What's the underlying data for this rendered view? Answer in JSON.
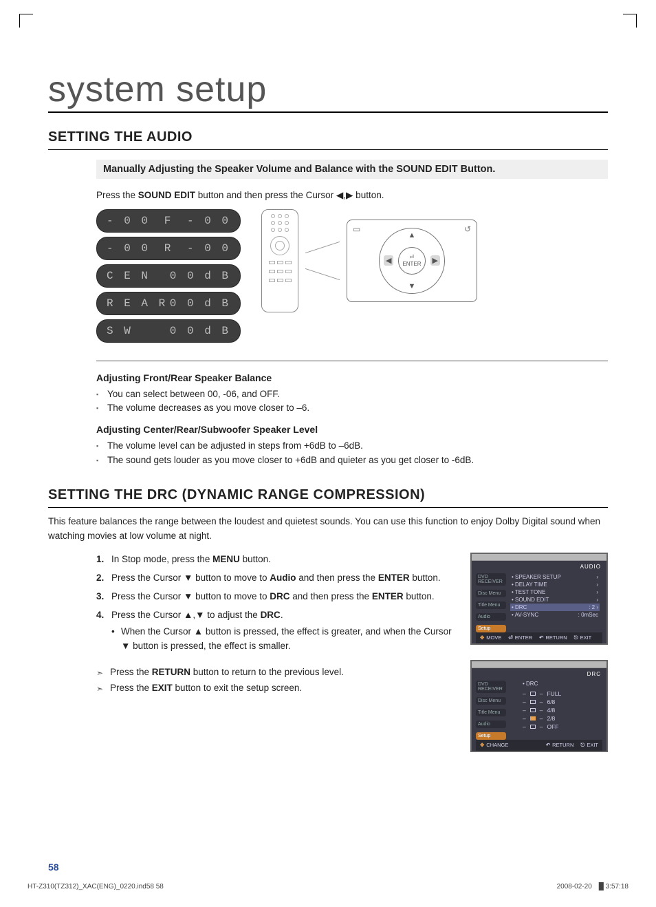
{
  "chapter_title": "system setup",
  "section1": {
    "heading": "SETTING THE AUDIO",
    "sub_band": "Manually Adjusting the Speaker Volume and Balance with the SOUND EDIT Button.",
    "instruction_pre": "Press the ",
    "instruction_bold": "SOUND EDIT",
    "instruction_post": " button and then press the Cursor ◀,▶ button.",
    "lcd": [
      {
        "left": "- 0 0",
        "mid": "F",
        "right": "- 0 0"
      },
      {
        "left": "- 0 0",
        "mid": "R",
        "right": "- 0 0"
      },
      {
        "left": "C E N",
        "mid": "",
        "right": "0 0 d B"
      },
      {
        "left": "R E A R",
        "mid": "",
        "right": "0 0 d B"
      },
      {
        "left": "S W",
        "mid": "",
        "right": "0 0 d B"
      }
    ],
    "dpad": {
      "corner_tl": "▭",
      "corner_tr": "↺",
      "center_icon": "⏎",
      "center_label": "ENTER"
    },
    "adj1_head": "Adjusting Front/Rear Speaker Balance",
    "adj1_b1": "You can select between 00, -06, and OFF.",
    "adj1_b2": "The volume decreases as you move closer to –6.",
    "adj2_head": "Adjusting Center/Rear/Subwoofer Speaker Level",
    "adj2_b1": "The volume level can be adjusted in steps from +6dB to –6dB.",
    "adj2_b2": "The sound gets louder as you move closer to +6dB and quieter as you get closer to -6dB."
  },
  "section2": {
    "heading": "SETTING THE DRC (DYNAMIC RANGE COMPRESSION)",
    "lead": "This feature balances the range between the loudest and quietest sounds. You can use this function to enjoy Dolby Digital sound when watching movies at low volume at night.",
    "steps": {
      "s1_pre": "In Stop mode, press the ",
      "s1_b": "MENU",
      "s1_post": " button.",
      "s2_pre": "Press the Cursor ▼ button to move to ",
      "s2_b": "Audio",
      "s2_mid": " and then press the ",
      "s2_b2": "ENTER",
      "s2_post": " button.",
      "s3_pre": "Press the Cursor ▼ button to move to ",
      "s3_b": "DRC",
      "s3_mid": " and then press the ",
      "s3_b2": "ENTER",
      "s3_post": " button.",
      "s4_pre": "Press the Cursor ▲,▼ to adjust the ",
      "s4_b": "DRC",
      "s4_post": ".",
      "s4_sub": "When the Cursor ▲ button is pressed, the effect is greater, and when the Cursor ▼ button is pressed, the effect is smaller."
    },
    "then": {
      "t1_pre": "Press the ",
      "t1_b": "RETURN",
      "t1_post": " button to return to the previous level.",
      "t2_pre": "Press the ",
      "t2_b": "EXIT",
      "t2_post": " button to exit the setup screen."
    },
    "osd1": {
      "top_right": "AUDIO",
      "nav": [
        "DVD RECEIVER",
        "Disc Menu",
        "Title Menu",
        "Audio",
        "Setup"
      ],
      "rows": [
        {
          "l": "SPEAKER SETUP",
          "r": "›"
        },
        {
          "l": "DELAY TIME",
          "r": "›"
        },
        {
          "l": "TEST TONE",
          "r": "›"
        },
        {
          "l": "SOUND EDIT",
          "r": "›"
        },
        {
          "l": "DRC",
          "r": ": 2         ›",
          "sel": true
        },
        {
          "l": "AV-SYNC",
          "r": ": 0mSec"
        }
      ],
      "foot": [
        "MOVE",
        "ENTER",
        "RETURN",
        "EXIT"
      ]
    },
    "osd2": {
      "top_right": "DRC",
      "nav": [
        "DVD RECEIVER",
        "Disc Menu",
        "Title Menu",
        "Audio",
        "Setup"
      ],
      "label": "DRC",
      "options": [
        {
          "l": "FULL",
          "sel": false
        },
        {
          "l": "6/8",
          "sel": false
        },
        {
          "l": "4/8",
          "sel": false
        },
        {
          "l": "2/8",
          "sel": true
        },
        {
          "l": "OFF",
          "sel": false
        }
      ],
      "foot": [
        "CHANGE",
        "RETURN",
        "EXIT"
      ]
    }
  },
  "page_number": "58",
  "footer": {
    "left": "HT-Z310(TZ312)_XAC(ENG)_0220.ind58   58",
    "right_date": "2008-02-20",
    "right_time": "█ 3:57:18"
  }
}
